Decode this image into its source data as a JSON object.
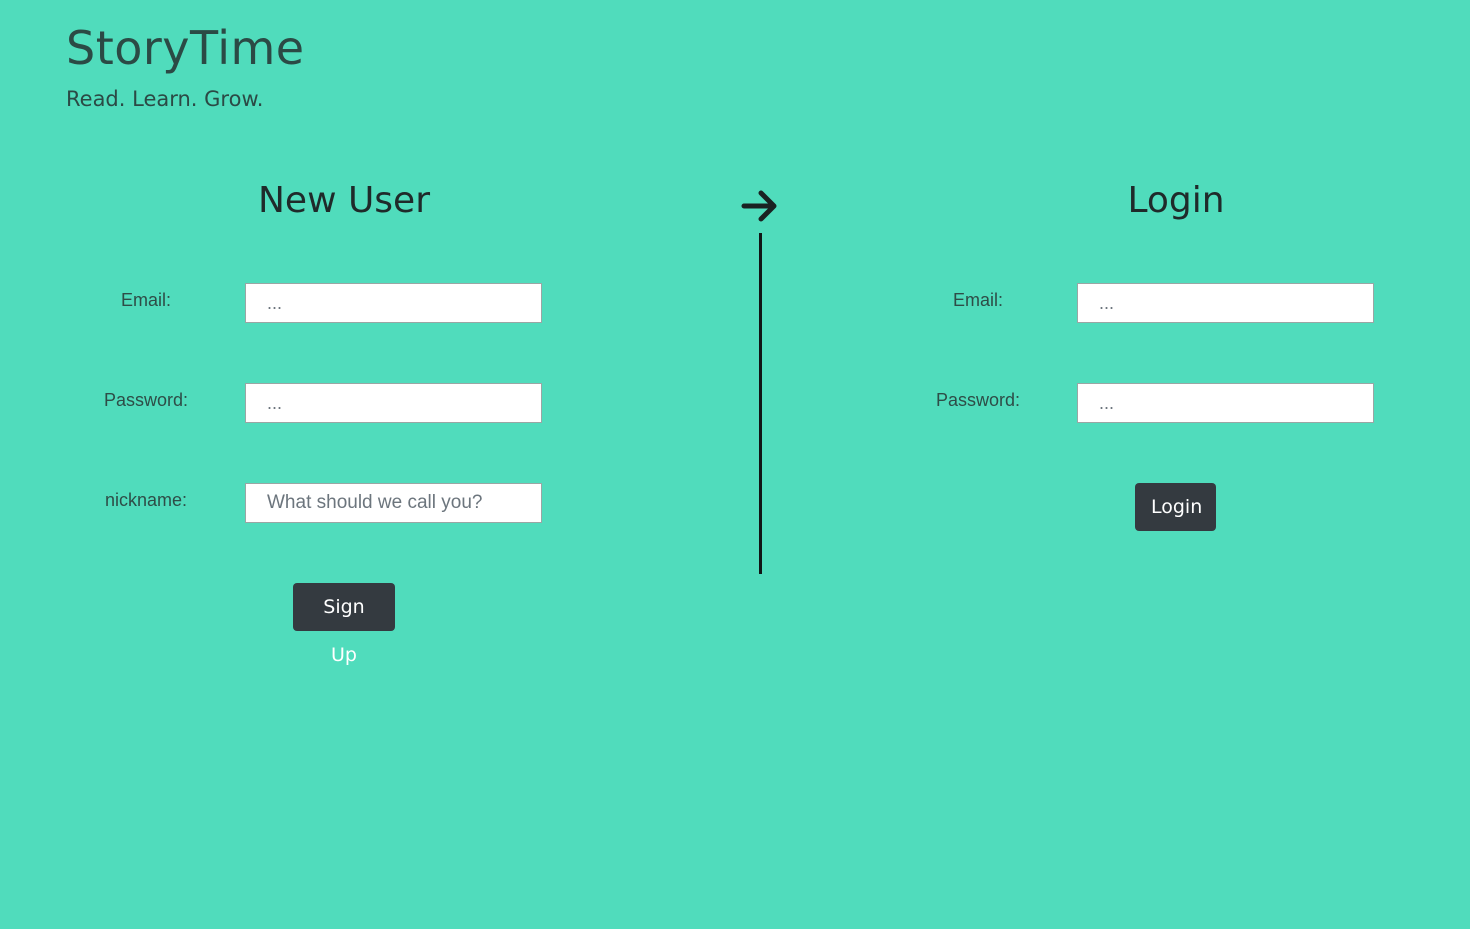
{
  "brand": {
    "title": "StoryTime",
    "tagline": "Read. Learn. Grow."
  },
  "signup": {
    "title": "New User",
    "email_label": "Email:",
    "email_placeholder": "...",
    "password_label": "Password:",
    "password_placeholder": "...",
    "nickname_label": "nickname:",
    "nickname_placeholder": "What should we call you?",
    "submit_label": "Sign Up"
  },
  "divider": {
    "icon": "arrow-right-icon"
  },
  "login": {
    "title": "Login",
    "email_label": "Email:",
    "email_placeholder": "...",
    "password_label": "Password:",
    "password_placeholder": "...",
    "submit_label": "Login"
  },
  "colors": {
    "background": "#50dcbc",
    "button": "#343a40",
    "text_dark": "#1f2a2a"
  }
}
